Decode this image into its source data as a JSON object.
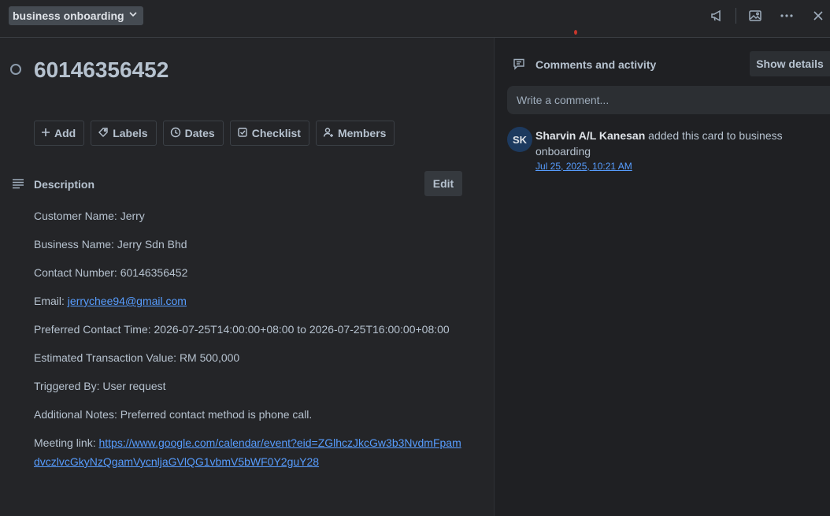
{
  "header": {
    "list_name": "business onboarding",
    "icons": [
      "megaphone-icon",
      "image-icon",
      "more-icon",
      "close-icon"
    ]
  },
  "card": {
    "title": "60146356452"
  },
  "actions": [
    {
      "label": "Add",
      "icon": "plus-icon"
    },
    {
      "label": "Labels",
      "icon": "tag-icon"
    },
    {
      "label": "Dates",
      "icon": "clock-icon"
    },
    {
      "label": "Checklist",
      "icon": "checkbox-icon"
    },
    {
      "label": "Members",
      "icon": "user-add-icon"
    }
  ],
  "description": {
    "heading": "Description",
    "edit_label": "Edit",
    "customer": "Customer Name: Jerry",
    "business": "Business Name: Jerry Sdn Bhd",
    "contact": "Contact Number: 60146356452",
    "email_label": "Email: ",
    "email": "jerrychee94@gmail.com",
    "time": "Preferred Contact Time: 2026-07-25T14:00:00+08:00 to 2026-07-25T16:00:00+08:00",
    "value": "Estimated Transaction Value: RM 500,000",
    "trigger": "Triggered By: User request",
    "notes": "Additional Notes: Preferred contact method is phone call.",
    "meeting_label": "Meeting link: ",
    "meeting_url": "https://www.google.com/calendar/event?eid=ZGlhczJkcGw3b3NvdmFpamdvczlvcGkyNzQgamVycnljaGVlQG1vbmV5bWF0Y2guY28"
  },
  "comments": {
    "heading": "Comments and activity",
    "show_details": "Show details",
    "placeholder": "Write a comment...",
    "activity": {
      "initials": "SK",
      "user": "Sharvin A/L Kanesan",
      "action": " added this card to business onboarding",
      "time": "Jul 25, 2025, 10:21 AM"
    }
  },
  "colors": {
    "background": "#242528",
    "panel": "#1f2023",
    "link": "#579dff",
    "avatar": "#1d3a5f"
  }
}
